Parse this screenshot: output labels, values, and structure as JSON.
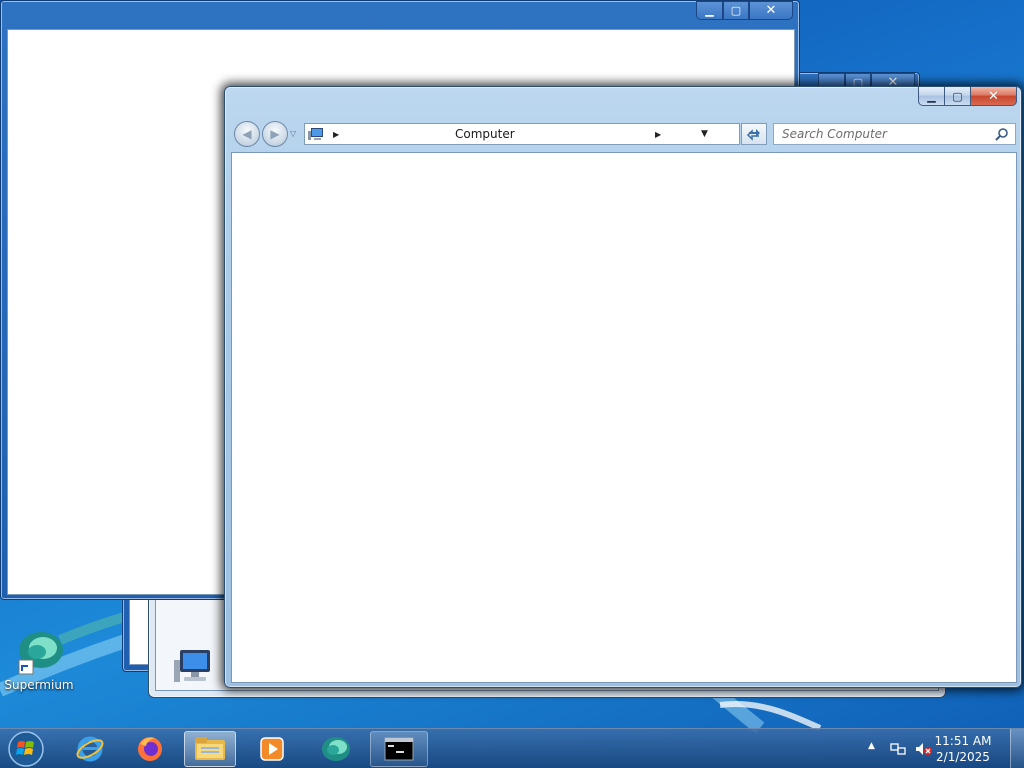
{
  "explorer": {
    "address_location": "Computer",
    "search_placeholder": "Search Computer"
  },
  "desktop": {
    "icons": [
      {
        "label": "Supermium",
        "icon": "supermium-icon"
      }
    ]
  },
  "caption_glyphs": {
    "minimize": "▁",
    "maximize": "▢",
    "close": "✕"
  },
  "taskbar": {
    "items": [
      {
        "name": "start-button",
        "icon": "windows-logo-icon"
      },
      {
        "name": "internet-explorer",
        "icon": "internet-explorer-icon"
      },
      {
        "name": "firefox",
        "icon": "firefox-icon"
      },
      {
        "name": "windows-explorer",
        "icon": "folder-icon",
        "state": "active"
      },
      {
        "name": "media-player",
        "icon": "media-player-icon"
      },
      {
        "name": "supermium",
        "icon": "supermium-icon"
      },
      {
        "name": "command-prompt",
        "icon": "cmd-icon",
        "state": "running"
      }
    ],
    "clock_time": "11:51 AM",
    "clock_date": "2/1/2025"
  },
  "colors": {
    "desktop_blue": "#1670c9",
    "taskbar": "#1f4a7f",
    "close_button_red": "#c8452d",
    "explorer_frame": "#a7c8e6"
  }
}
